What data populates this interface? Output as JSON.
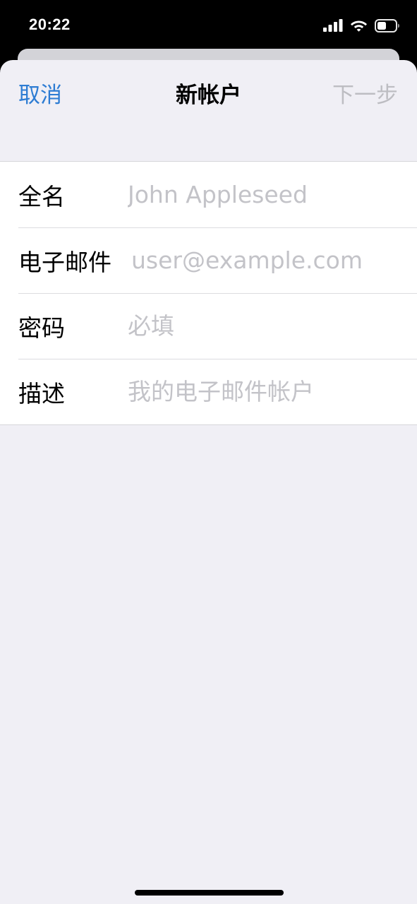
{
  "status_bar": {
    "time": "20:22",
    "icons": [
      "signal-icon",
      "wifi-icon",
      "battery-icon"
    ]
  },
  "nav": {
    "cancel_label": "取消",
    "title": "新帐户",
    "next_label": "下一步"
  },
  "form": {
    "rows": [
      {
        "label": "全名",
        "placeholder": "John Appleseed",
        "value": ""
      },
      {
        "label": "电子邮件",
        "placeholder": "user@example.com",
        "value": ""
      },
      {
        "label": "密码",
        "placeholder": "必填",
        "value": ""
      },
      {
        "label": "描述",
        "placeholder": "我的电子邮件帐户",
        "value": ""
      }
    ]
  },
  "colors": {
    "accent": "#2d7cd3",
    "disabled": "#bdbdc2",
    "placeholder": "#c3c3c8",
    "background": "#f0eff5"
  }
}
